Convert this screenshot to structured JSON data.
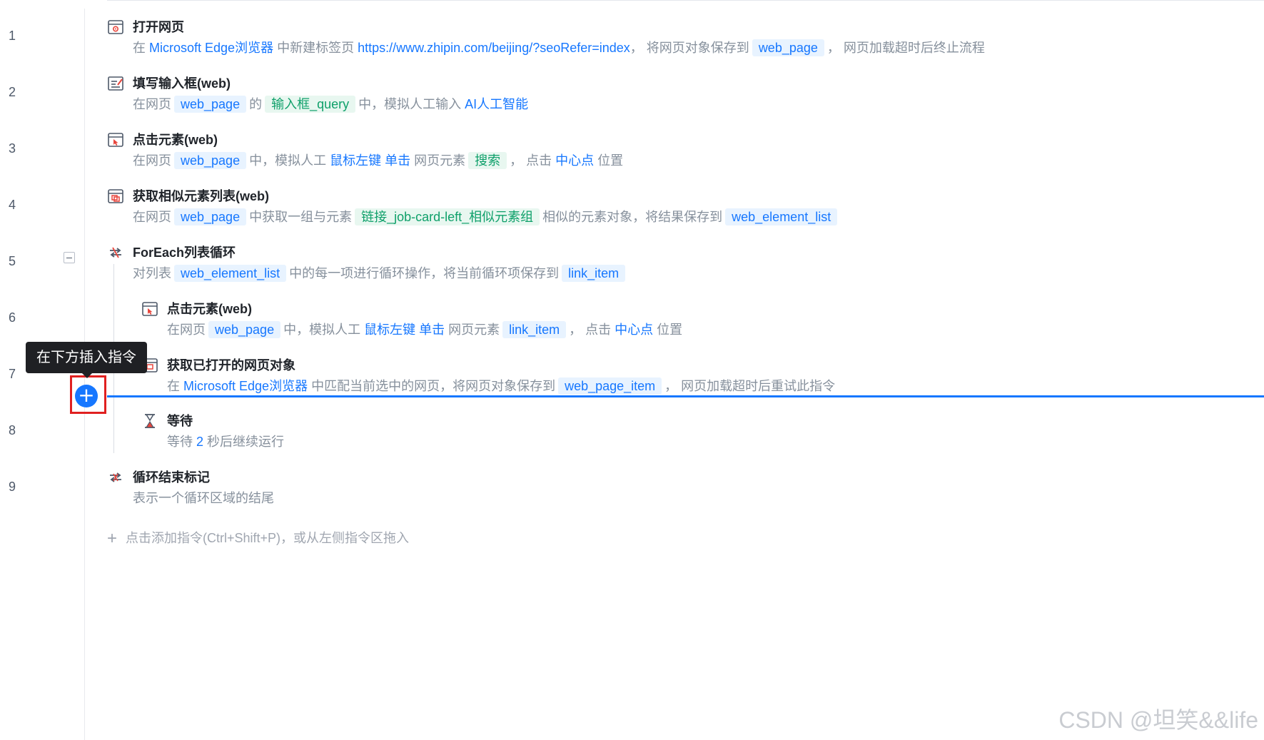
{
  "line_numbers": [
    "1",
    "2",
    "3",
    "4",
    "5",
    "6",
    "7",
    "8",
    "9"
  ],
  "steps": [
    {
      "title": "打开网页",
      "icon": "browser-open-icon",
      "d1": "在 ",
      "d2": "Microsoft Edge浏览器",
      "d3": " 中新建标签页 ",
      "d4": "https://www.zhipin.com/beijing/?seoRefer=index",
      "d5": "， 将网页对象保存到",
      "var1": "web_page",
      "d6": "， 网页加载超时后终止流程"
    },
    {
      "title": "填写输入框(web)",
      "icon": "input-fill-icon",
      "d1": "在网页",
      "var1": "web_page",
      "d2": "的",
      "elem1": "输入框_query",
      "d3": "中，模拟人工输入 ",
      "d4": "AI人工智能"
    },
    {
      "title": "点击元素(web)",
      "icon": "click-element-icon",
      "d1": "在网页",
      "var1": "web_page",
      "d2": "中，模拟人工 ",
      "d3": "鼠标左键",
      "d4": " ",
      "d5": "单击",
      "d6": " 网页元素",
      "elem1": "搜索",
      "d7": "， 点击 ",
      "d8": "中心点",
      "d9": " 位置"
    },
    {
      "title": "获取相似元素列表(web)",
      "icon": "similar-elements-icon",
      "d1": "在网页",
      "var1": "web_page",
      "d2": "中获取一组与元素",
      "elem1": "链接_job-card-left_相似元素组",
      "d3": "相似的元素对象，将结果保存到",
      "var2": "web_element_list"
    },
    {
      "title": "ForEach列表循环",
      "icon": "loop-icon",
      "d1": "对列表",
      "var1": "web_element_list",
      "d2": "中的每一项进行循环操作，将当前循环项保存到",
      "var2": "link_item"
    },
    {
      "title": "点击元素(web)",
      "icon": "click-element-icon",
      "d1": "在网页",
      "var1": "web_page",
      "d2": "中，模拟人工 ",
      "d3": "鼠标左键",
      "d4": " ",
      "d5": "单击",
      "d6": " 网页元素",
      "var2": "link_item",
      "d7": "， 点击 ",
      "d8": "中心点",
      "d9": " 位置"
    },
    {
      "title": "获取已打开的网页对象",
      "icon": "browser-get-icon",
      "d1": "在 ",
      "d2": "Microsoft Edge浏览器",
      "d3": " 中匹配当前选中的网页，将网页对象保存到",
      "var1": "web_page_item",
      "d4": "， 网页加载超时后重试此指令"
    },
    {
      "title": "等待",
      "icon": "hourglass-icon",
      "d1": "等待 ",
      "d2": "2",
      "d3": " 秒后继续运行"
    },
    {
      "title": "循环结束标记",
      "icon": "loop-end-icon",
      "d1": "表示一个循环区域的结尾"
    }
  ],
  "insert": {
    "tooltip": "在下方插入指令",
    "button": "+"
  },
  "add_hint": {
    "plus": "+",
    "text": "点击添加指令(Ctrl+Shift+P)，或从左侧指令区拖入"
  },
  "watermark": "CSDN @坦笑&&life",
  "colors": {
    "accent": "#1677ff",
    "element_green": "#0fa06a",
    "highlight_red": "#e02020"
  }
}
